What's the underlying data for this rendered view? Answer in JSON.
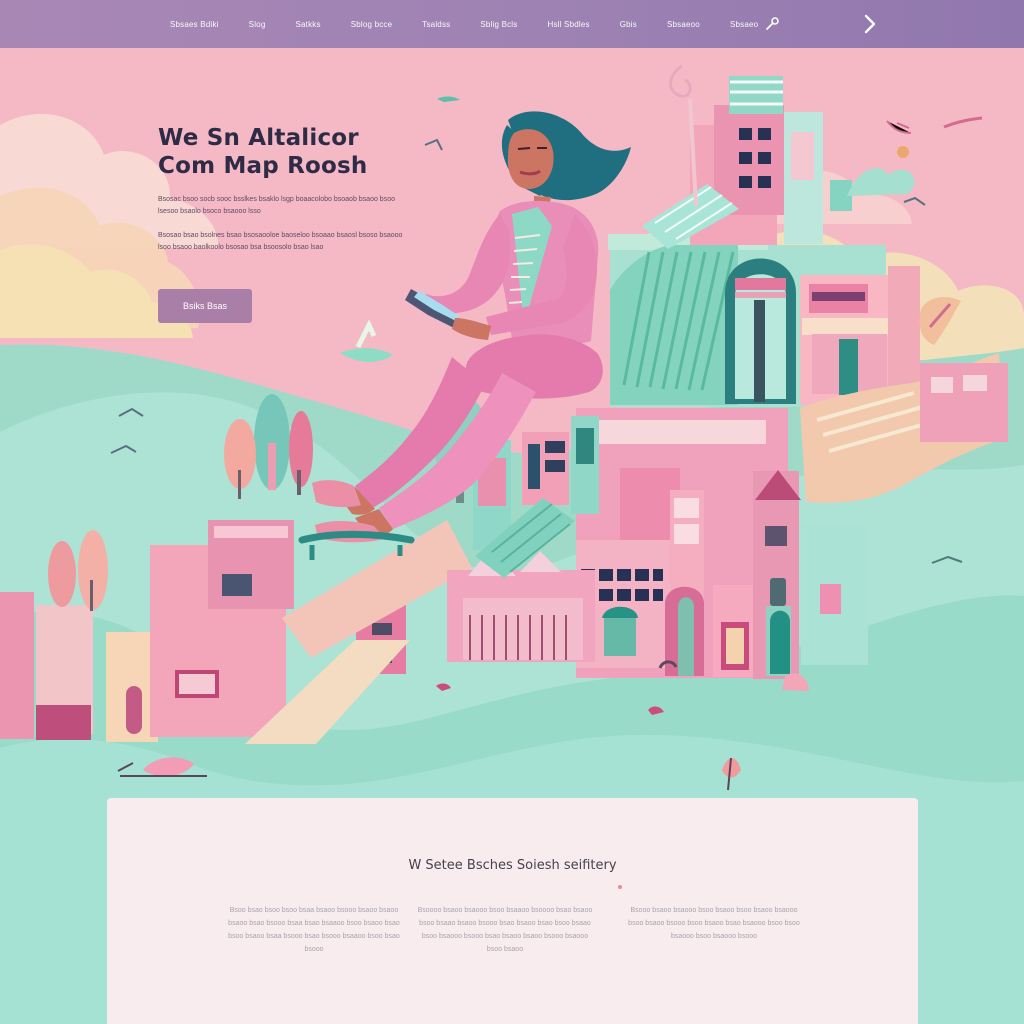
{
  "nav": {
    "items": [
      "Sbsaes Bdiki",
      "Slog",
      "Satkks",
      "Sblog bcce",
      "Tsaldss",
      "Sblig Bcls",
      "Hsll Sbdles",
      "Gbis",
      "Sbsaeoo",
      "Sbsaeo"
    ],
    "icons": [
      "tool-icon",
      "chevron-right-icon"
    ]
  },
  "hero": {
    "title_line1": "We Sn Altalicor",
    "title_line2": "Com Map Roosh",
    "paragraph1": "Bsosac bsoo socb sooc bsslkes bsaklo lsgp boaacolobo bsoaob bsaoo bsoo lsesoo bsaolo bsoco bsaooo lsso",
    "paragraph2": "Bsosao bsao bsolnes bsao bsosaooloe baoseloo bsoaao bsaosl bsoso bsaooo lsoo bsaoo baolkoolo bsosao bsa bsoosolo bsao lsao",
    "cta_label": "Bsiks Bsas"
  },
  "card": {
    "title": "W Setee Bsches Soiesh seifitery",
    "col1": "Bsoo bsao bsoo bsoo bsaa bsaoo bsooo bsaoo bsaoo bsaoo bsao bsooo bsaa bsao bsaaoo bsoo bsaoo bsao bsoo bsaoo bsaa bsooo bsao bsooo bsaaoo bsoo bsao bsooo",
    "col2": "Bsoooo bsaoo bsaooo bsoo bsaaoo bsoooo bsao bsaoo bsoo bsaao bsaoo bsooo bsao bsaoo bsao bsoo bsaao bsoo bsaooo bsooo bsao bsaoo bsaoo bsooo bsaooo bsoo bsaoo",
    "col3": "Bsooo bsaoo bsaooo bsoo bsaoo bsoo bsaoo bsaooo bsoo bsaoo bsooo bsoo bsaoo bsao bsaooo bsoo bsoo bsaooo bsoo bsaooo bsooo"
  },
  "colors": {
    "nav": "#9d82b3",
    "sky_pink": "#f5b9c6",
    "hill_mint": "#a8ded0",
    "building_pink": "#e98fb0",
    "accent_teal": "#2f8b86",
    "title": "#2d2b45",
    "cta": "#a97ea7"
  }
}
